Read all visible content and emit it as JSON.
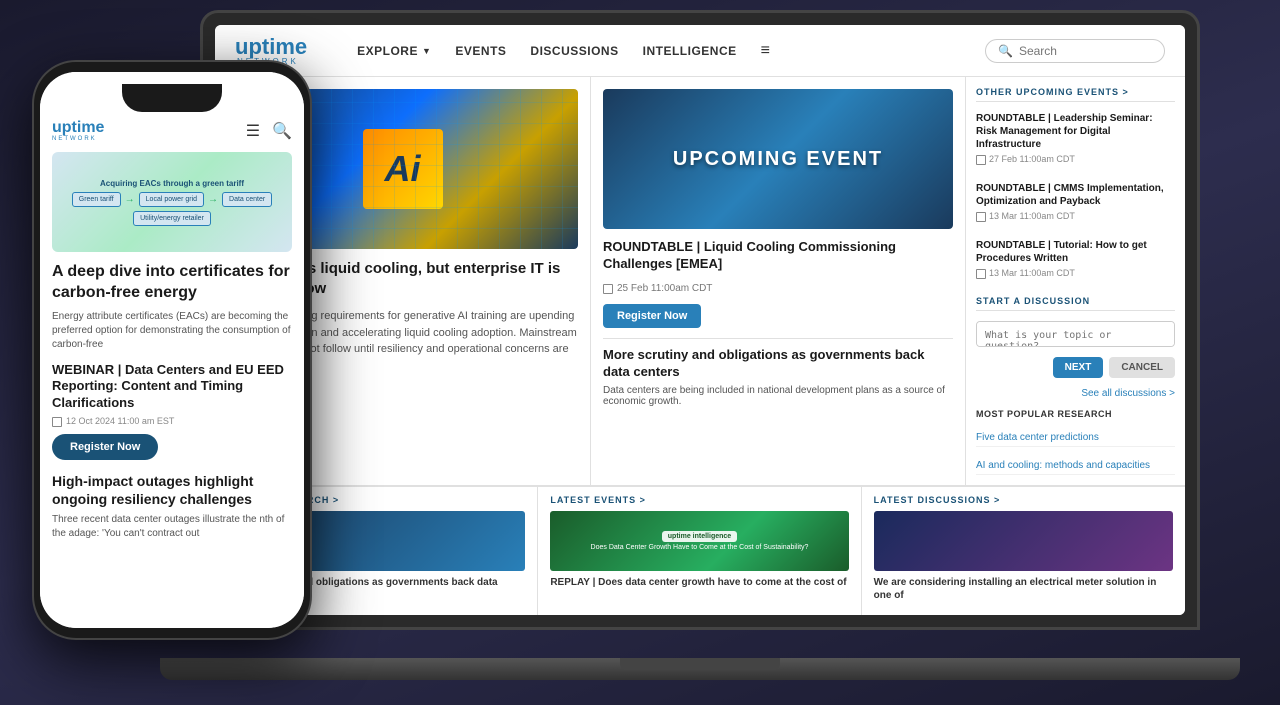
{
  "background": {
    "color": "#1a1a2e"
  },
  "laptop": {
    "header": {
      "logo": {
        "uptime": "uptime",
        "network": "NETWORK"
      },
      "nav": {
        "items": [
          {
            "label": "EXPLORE",
            "hasArrow": true
          },
          {
            "label": "EVENTS"
          },
          {
            "label": "DISCUSSIONS"
          },
          {
            "label": "INTELLIGENCE"
          }
        ]
      },
      "search_placeholder": "Search"
    },
    "main_article": {
      "title": "AI embraces liquid cooling, but enterprise IT is slow to follow",
      "body": "Power and cooling requirements for generative AI training are upending data center design and accelerating liquid cooling adoption. Mainstream business IT will not follow until resiliency and operational concerns are addressed."
    },
    "event": {
      "label": "UPCOMING EVENT",
      "title": "ROUNDTABLE | Liquid Cooling Commissioning Challenges [EMEA]",
      "date": "25 Feb   11:00am CDT",
      "register_label": "Register Now"
    },
    "scrutiny": {
      "title": "More scrutiny and obligations as governments back data centers",
      "body": "Data centers are being included in national development plans as a source of economic growth."
    },
    "sidebar": {
      "events_header": "OTHER UPCOMING EVENTS  >",
      "events": [
        {
          "title": "ROUNDTABLE | Leadership Seminar: Risk Management for Digital Infrastructure",
          "date": "27 Feb   11:00am CDT"
        },
        {
          "title": "ROUNDTABLE | CMMS Implementation, Optimization and Payback",
          "date": "13 Mar   11:00am CDT"
        },
        {
          "title": "ROUNDTABLE | Tutorial: How to get Procedures Written",
          "date": "13 Mar   11:00am CDT"
        }
      ],
      "discussion_header": "START A DISCUSSION",
      "discussion_placeholder": "What is your topic or question?",
      "btn_next": "NEXT",
      "btn_cancel": "CANCEL",
      "see_all_label": "See all discussions >",
      "popular_header": "MOST POPULAR RESEARCH",
      "popular_items": [
        "Five data center predictions",
        "AI and cooling: methods and capacities",
        ""
      ]
    },
    "bottom": {
      "research": {
        "header": "LATEST RESEARCH >",
        "text": "More scrutiny and obligations as governments back data centers"
      },
      "events": {
        "header": "LATEST EVENTS >",
        "text": "REPLAY | Does data center growth have to come at the cost of"
      },
      "discussions": {
        "header": "LATEST DISCUSSIONS >",
        "text": "We are considering installing an electrical meter solution in one of"
      }
    }
  },
  "phone": {
    "logo": {
      "uptime": "uptime",
      "network": "NETWORK"
    },
    "article1": {
      "image_title": "Acquiring EACs through a green tariff",
      "title": "A deep dive into certificates for carbon-free energy",
      "body": "Energy attribute certificates (EACs) are becoming the preferred option for demonstrating the consumption of carbon-free"
    },
    "article2": {
      "title": "WEBINAR | Data Centers and EU EED Reporting: Content and Timing Clarifications",
      "date": "12 Oct 2024 11:00 am EST",
      "register_label": "Register Now"
    },
    "article3": {
      "title": "High-impact outages highlight ongoing resiliency challenges",
      "body": "Three recent data center outages illustrate the nth of the adage: 'You can't contract out"
    }
  }
}
